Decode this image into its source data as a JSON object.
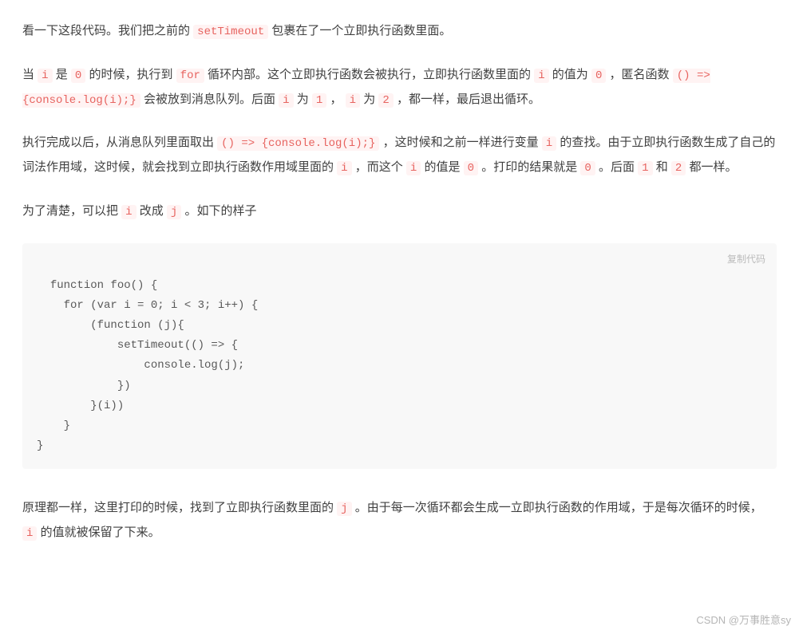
{
  "para1": {
    "t0": "看一下这段代码。我们把之前的 ",
    "c0": "setTimeout",
    "t1": " 包裹在了一个立即执行函数里面。"
  },
  "para2": {
    "t0": "当 ",
    "c0": "i",
    "t1": " 是 ",
    "c1": "0",
    "t2": " 的时候，执行到 ",
    "c2": "for",
    "t3": " 循环内部。这个立即执行函数会被执行，立即执行函数里面的 ",
    "c3": "i",
    "t4": " 的值为 ",
    "c4": "0",
    "t5": " ，匿名函数 ",
    "c5": "() => {console.log(i);}",
    "t6": " 会被放到消息队列。后面 ",
    "c6": "i",
    "t7": " 为 ",
    "c7": "1",
    "t8": " ， ",
    "c8": "i",
    "t9": " 为 ",
    "c9": "2",
    "t10": " ，都一样，最后退出循环。"
  },
  "para3": {
    "t0": "执行完成以后，从消息队列里面取出 ",
    "c0": "() => {console.log(i);}",
    "t1": " ，这时候和之前一样进行变量 ",
    "c1": "i",
    "t2": " 的查找。由于立即执行函数生成了自己的词法作用域，这时候，就会找到立即执行函数作用域里面的 ",
    "c2": "i",
    "t3": " ，而这个 ",
    "c3": "i",
    "t4": " 的值是 ",
    "c4": "0",
    "t5": " 。打印的结果就是 ",
    "c5": "0",
    "t6": " 。后面 ",
    "c6": "1",
    "t7": " 和 ",
    "c7": "2",
    "t8": " 都一样。"
  },
  "para4": {
    "t0": "为了清楚，可以把 ",
    "c0": "i",
    "t1": " 改成 ",
    "c1": "j",
    "t2": " 。如下的样子"
  },
  "codeblock": {
    "copy_label": "复制代码",
    "code": "function foo() {\n    for (var i = 0; i < 3; i++) {\n        (function (j){\n            setTimeout(() => {\n                console.log(j);\n            })\n        }(i))\n    }\n}"
  },
  "para5": {
    "t0": "原理都一样，这里打印的时候，找到了立即执行函数里面的 ",
    "c0": "j",
    "t1": " 。由于每一次循环都会生成一立即执行函数的作用域，于是每次循环的时候， ",
    "c1": "i",
    "t2": " 的值就被保留了下来。"
  },
  "watermark": "CSDN @万事胜意sy"
}
